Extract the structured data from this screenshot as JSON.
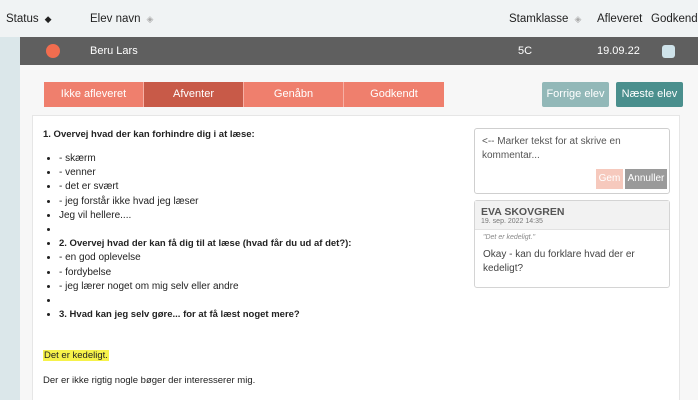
{
  "header": {
    "status": "Status",
    "elev_navn": "Elev navn",
    "stamklasse": "Stamklasse",
    "afleveret": "Afleveret",
    "godkendt": "Godkend",
    "sort_glyph": "◆",
    "sort_glyph_light": "◈"
  },
  "student": {
    "name": "Beru Lars",
    "class": "5C",
    "date": "19.09.22",
    "status_color": "#f26d4f"
  },
  "tabs": [
    "Ikke afleveret",
    "Afventer",
    "Genåbn",
    "Godkendt"
  ],
  "active_tab": "Afventer",
  "nav": {
    "prev": "Forrige elev",
    "next": "Næste elev"
  },
  "content": {
    "q1": "1. Overvej hvad der kan forhindre dig i at læse:",
    "items": [
      "- skærm",
      "- venner",
      "- det er svært",
      "- jeg forstår ikke hvad jeg læser",
      "Jeg vil hellere....",
      "",
      "2. Overvej hvad der kan få dig til at læse (hvad får du ud af det?):",
      "- en god oplevelse",
      "- fordybelse",
      "- jeg lærer noget om mig selv eller andre",
      "",
      "3. Hvad kan jeg selv gøre... for at få læst noget mere?"
    ],
    "highlighted": "Det er kedeligt.",
    "answer": "Der er ikke rigtig nogle bøger der interesserer mig."
  },
  "comment_box": {
    "placeholder": "<-- Marker tekst for at skrive en kommentar...",
    "save": "Gem",
    "cancel": "Annuller"
  },
  "comment": {
    "author": "EVA SKOVGREN",
    "date": "19. sep. 2022 14:35",
    "quote": "\"Det er kedeligt.\"",
    "text": "Okay - kan du forklare hvad der er kedeligt?"
  },
  "colors": {
    "tab": "#ef7f6d",
    "tab_active": "#c85a48",
    "next_button": "#4a8f8d",
    "prev_button": "#92b8b8",
    "highlight": "#f6f24a"
  }
}
